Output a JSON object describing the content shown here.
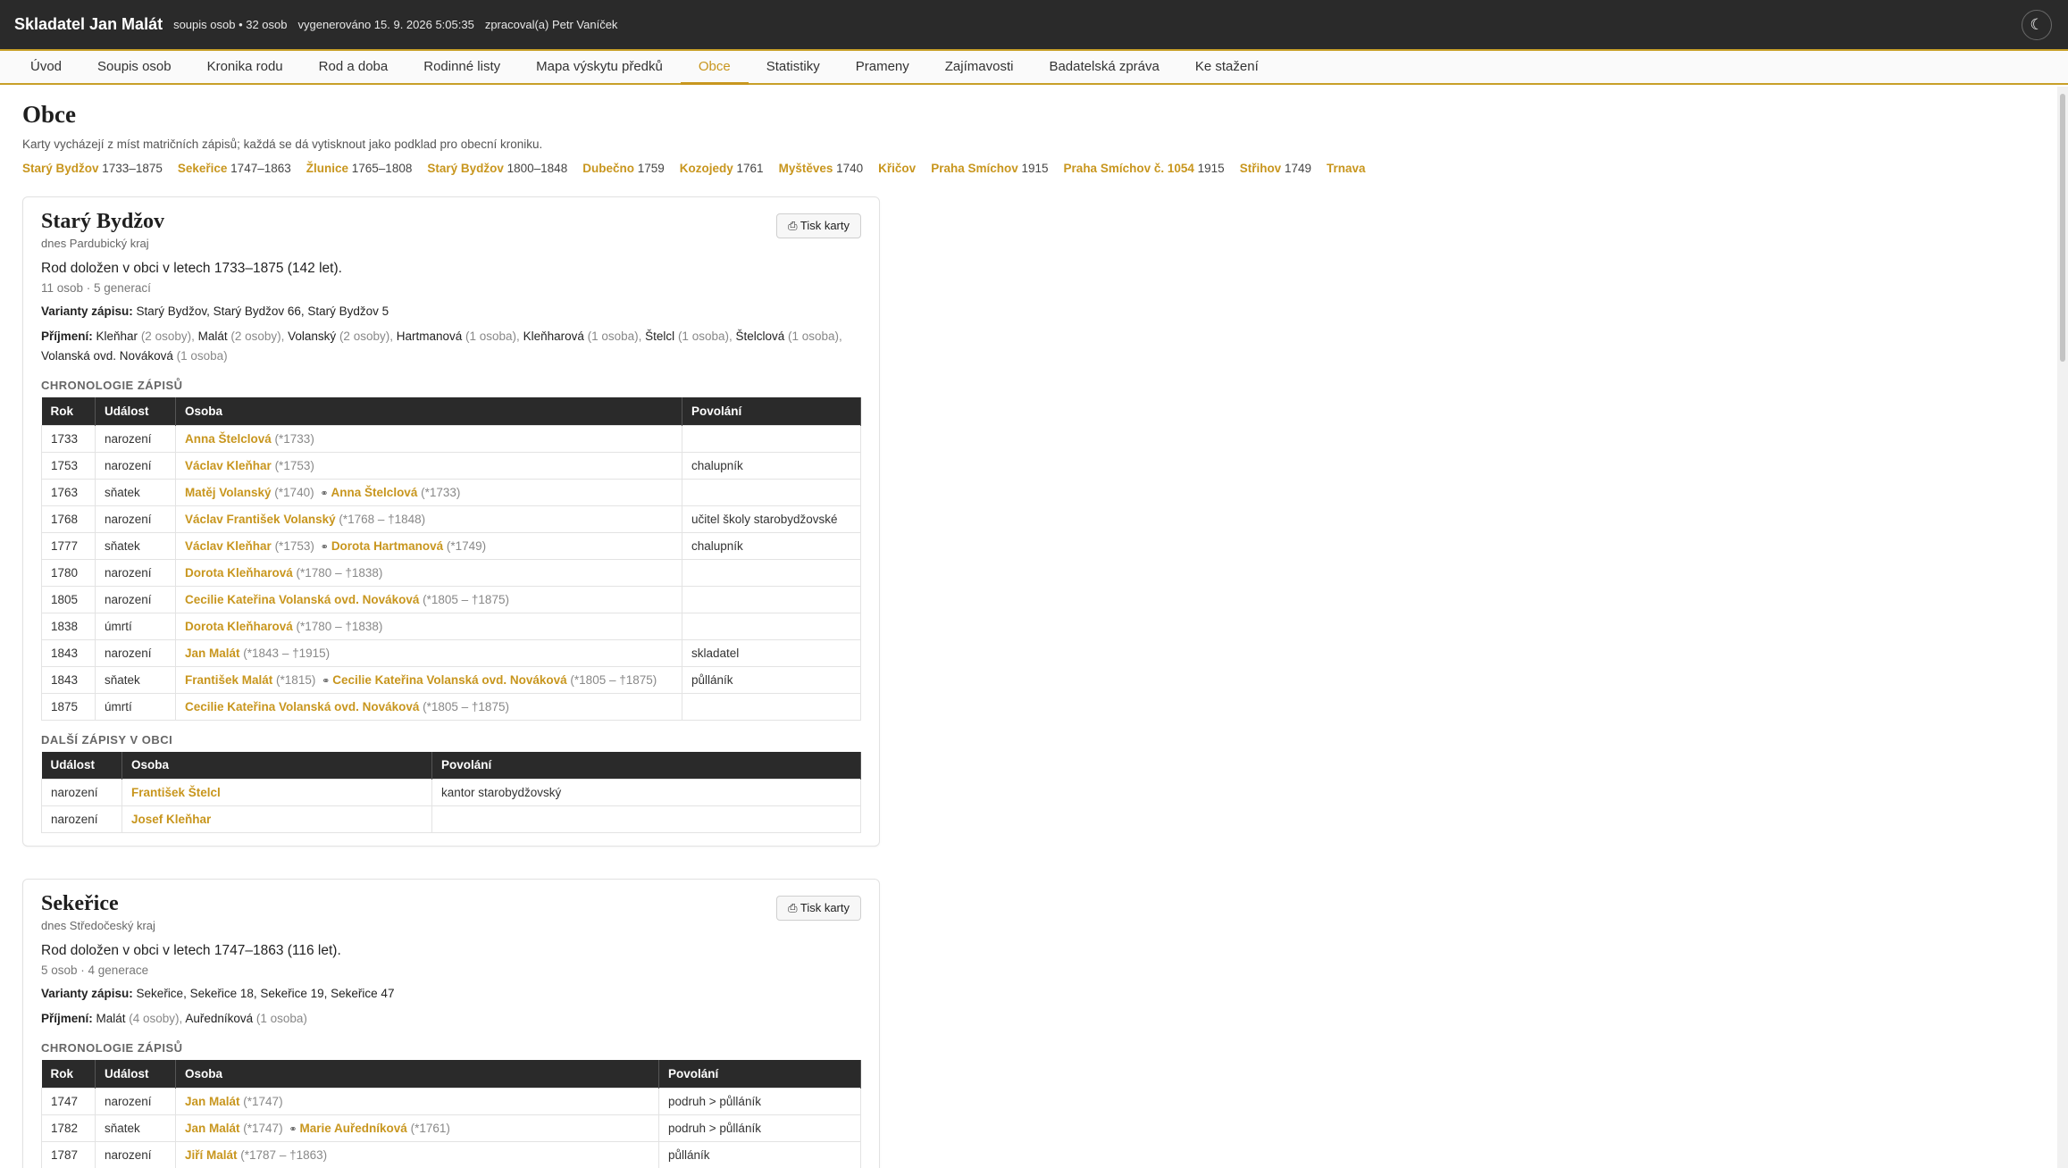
{
  "header": {
    "title": "Skladatel Jan Malát",
    "meta": [
      "soupis osob • 32 osob",
      "vygenerováno 15. 9. 2026 5:05:35",
      "zpracoval(a) Petr Vaníček"
    ],
    "theme_icon": "moon-icon",
    "theme_glyph": "☾"
  },
  "nav": [
    "Úvod",
    "Soupis osob",
    "Kronika rodu",
    "Rod a doba",
    "Rodinné listy",
    "Mapa výskytu předků",
    "Obce",
    "Statistiky",
    "Prameny",
    "Zajímavosti",
    "Badatelská zpráva",
    "Ke stažení"
  ],
  "nav_active": "Obce",
  "page": {
    "title": "Obce",
    "description": "Karty vycházejí z míst matričních zápisů; každá se dá vytisknout jako podklad pro obecní kroniku.",
    "jump_list": [
      {
        "name": "Starý Bydžov",
        "years": "1733–1875"
      },
      {
        "name": "Sekeřice",
        "years": "1747–1863"
      },
      {
        "name": "Žlunice",
        "years": "1765–1808"
      },
      {
        "name": "Starý Bydžov",
        "years": "1800–1848"
      },
      {
        "name": "Dubečno",
        "years": "1759"
      },
      {
        "name": "Kozojedy",
        "years": "1761"
      },
      {
        "name": "Myštěves",
        "years": "1740"
      },
      {
        "name": "Křičov",
        "years": ""
      },
      {
        "name": "Praha Smíchov",
        "years": "1915"
      },
      {
        "name": "Praha Smíchov č. 1054",
        "years": "1915"
      },
      {
        "name": "Střihov",
        "years": "1749"
      },
      {
        "name": "Trnava",
        "years": ""
      }
    ]
  },
  "labels": {
    "print": "Tisk karty",
    "print_icon": "printer-icon",
    "variants": "Varianty zápisu:",
    "surnames": "Příjmení:",
    "chronology": "CHRONOLOGIE ZÁPISŮ",
    "other_records": "DALŠÍ ZÁPISY V OBCI",
    "col_year": "Rok",
    "col_event": "Událost",
    "col_person": "Osoba",
    "col_occupation": "Povolání"
  },
  "cards": [
    {
      "name": "Starý Bydžov",
      "region": "dnes Pardubický kraj",
      "summary": "Rod doložen v obci v letech 1733–1875 (142 let).",
      "counts": "11 osob · 5 generací",
      "variants": "Starý Bydžov, Starý Bydžov 66, Starý Bydžov 5",
      "surnames": [
        {
          "name": "Kleňhar",
          "count": "(2 osoby)"
        },
        {
          "name": "Malát",
          "count": "(2 osoby)"
        },
        {
          "name": "Volanský",
          "count": "(2 osoby)"
        },
        {
          "name": "Hartmanová",
          "count": "(1 osoba)"
        },
        {
          "name": "Kleňharová",
          "count": "(1 osoba)"
        },
        {
          "name": "Štelcl",
          "count": "(1 osoba)"
        },
        {
          "name": "Štelclová",
          "count": "(1 osoba)"
        },
        {
          "name": "Volanská ovd. Nováková",
          "count": "(1 osoba)"
        }
      ],
      "chronology": [
        {
          "year": "1733",
          "event": "narození",
          "persons": [
            {
              "name": "Anna Štelclová",
              "dates": "(*1733)"
            }
          ],
          "occupation": ""
        },
        {
          "year": "1753",
          "event": "narození",
          "persons": [
            {
              "name": "Václav Kleňhar",
              "dates": "(*1753)"
            }
          ],
          "occupation": "chalupník"
        },
        {
          "year": "1763",
          "event": "sňatek",
          "persons": [
            {
              "name": "Matěj Volanský",
              "dates": "(*1740)"
            },
            {
              "name": "Anna Štelclová",
              "dates": "(*1733)"
            }
          ],
          "occupation": ""
        },
        {
          "year": "1768",
          "event": "narození",
          "persons": [
            {
              "name": "Václav František Volanský",
              "dates": "(*1768 – †1848)"
            }
          ],
          "occupation": "učitel školy starobydžovské"
        },
        {
          "year": "1777",
          "event": "sňatek",
          "persons": [
            {
              "name": "Václav Kleňhar",
              "dates": "(*1753)"
            },
            {
              "name": "Dorota Hartmanová",
              "dates": "(*1749)"
            }
          ],
          "occupation": "chalupník"
        },
        {
          "year": "1780",
          "event": "narození",
          "persons": [
            {
              "name": "Dorota Kleňharová",
              "dates": "(*1780 – †1838)"
            }
          ],
          "occupation": ""
        },
        {
          "year": "1805",
          "event": "narození",
          "persons": [
            {
              "name": "Cecilie Kateřina Volanská ovd. Nováková",
              "dates": "(*1805 – †1875)"
            }
          ],
          "occupation": ""
        },
        {
          "year": "1838",
          "event": "úmrtí",
          "persons": [
            {
              "name": "Dorota Kleňharová",
              "dates": "(*1780 – †1838)"
            }
          ],
          "occupation": ""
        },
        {
          "year": "1843",
          "event": "narození",
          "persons": [
            {
              "name": "Jan Malát",
              "dates": "(*1843 – †1915)"
            }
          ],
          "occupation": "skladatel"
        },
        {
          "year": "1843",
          "event": "sňatek",
          "persons": [
            {
              "name": "František Malát",
              "dates": "(*1815)"
            },
            {
              "name": "Cecilie Kateřina Volanská ovd. Nováková",
              "dates": "(*1805 – †1875)"
            }
          ],
          "occupation": "půlláník"
        },
        {
          "year": "1875",
          "event": "úmrtí",
          "persons": [
            {
              "name": "Cecilie Kateřina Volanská ovd. Nováková",
              "dates": "(*1805 – †1875)"
            }
          ],
          "occupation": ""
        }
      ],
      "other_records": [
        {
          "event": "narození",
          "person": "František Štelcl",
          "occupation": "kantor starobydžovský"
        },
        {
          "event": "narození",
          "person": "Josef Kleňhar",
          "occupation": ""
        }
      ]
    },
    {
      "name": "Sekeřice",
      "region": "dnes Středočeský kraj",
      "summary": "Rod doložen v obci v letech 1747–1863 (116 let).",
      "counts": "5 osob · 4 generace",
      "variants": "Sekeřice, Sekeřice 18, Sekeřice 19, Sekeřice 47",
      "surnames": [
        {
          "name": "Malát",
          "count": "(4 osoby)"
        },
        {
          "name": "Auředníková",
          "count": "(1 osoba)"
        }
      ],
      "chronology": [
        {
          "year": "1747",
          "event": "narození",
          "persons": [
            {
              "name": "Jan Malát",
              "dates": "(*1747)"
            }
          ],
          "occupation": "podruh > půlláník"
        },
        {
          "year": "1782",
          "event": "sňatek",
          "persons": [
            {
              "name": "Jan Malát",
              "dates": "(*1747)"
            },
            {
              "name": "Marie Auředníková",
              "dates": "(*1761)"
            }
          ],
          "occupation": "podruh > půlláník"
        },
        {
          "year": "1787",
          "event": "narození",
          "persons": [
            {
              "name": "Jiří Malát",
              "dates": "(*1787 – †1863)"
            }
          ],
          "occupation": "půlláník"
        }
      ],
      "other_records": []
    }
  ]
}
